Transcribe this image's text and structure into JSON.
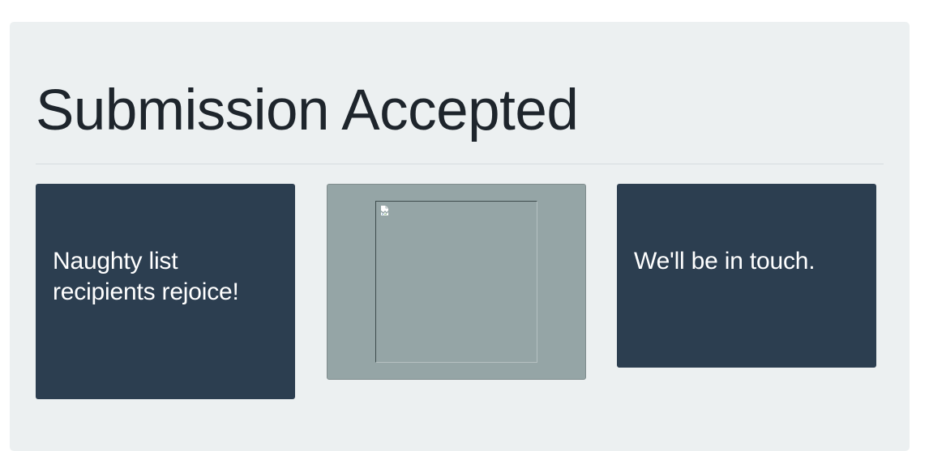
{
  "page": {
    "title": "Submission Accepted"
  },
  "cards": {
    "left": {
      "text": "Naughty list recipients rejoice!"
    },
    "middle": {
      "image_state": "broken-image",
      "icon": "broken-image-icon"
    },
    "right": {
      "text": "We'll be in touch."
    }
  },
  "colors": {
    "background": "#ecf0f1",
    "dark_card": "#2c3e50",
    "gray_card": "#95a5a6",
    "title": "#1e252c"
  }
}
